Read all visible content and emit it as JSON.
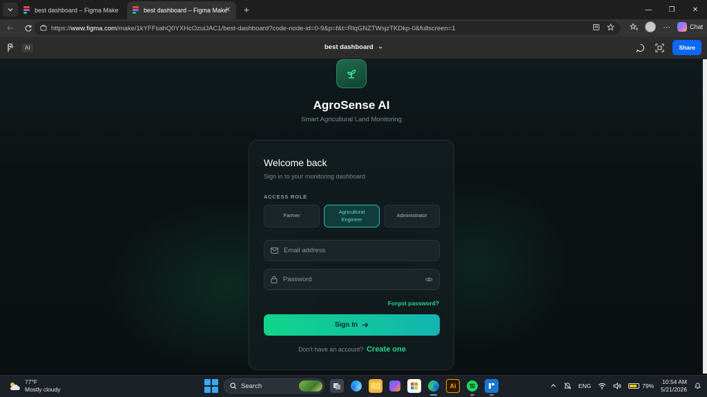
{
  "browser": {
    "tabs": [
      {
        "title": "best dashboard – Figma Make",
        "active": false
      },
      {
        "title": "best dashboard – Figma Make",
        "active": true
      }
    ],
    "url_prefix": "https://",
    "url_host": "www.figma.com",
    "url_path": "/make/1kYFFsahQ0YXHcOzulJAC1/best-dashboard?code-node-id=0-9&p=f&t=RlqGNZTWsjzTKDkp-0&fullscreen=1",
    "copilot_label": "Chat"
  },
  "figma": {
    "ai_label": "AI",
    "file_title": "best dashboard",
    "share_label": "Share"
  },
  "app": {
    "name": "AgroSense AI",
    "tagline": "Smart Agricultural Land Monitoring",
    "card": {
      "heading": "Welcome back",
      "subheading": "Sign in to your monitoring dashboard",
      "role_label": "ACCESS ROLE",
      "roles": [
        {
          "label": "Farmer",
          "selected": false
        },
        {
          "label": "Agricultural Engineer",
          "selected": true
        },
        {
          "label": "Administrator",
          "selected": false
        }
      ],
      "email_placeholder": "Email address",
      "password_placeholder": "Password",
      "forgot_label": "Forgot password?",
      "signin_label": "Sign In",
      "no_account_text": "Don't have an account?",
      "create_label": "Create one"
    },
    "colors": {
      "accent_green": "#22d58a",
      "accent_teal": "#1fc3b2",
      "card_bg": "#121c1f"
    }
  },
  "taskbar": {
    "weather_temp": "77°F",
    "weather_desc": "Mostly cloudy",
    "search_label": "Search",
    "language": "ENG",
    "battery": "79%",
    "battery_level": 0.79,
    "time": "10:54 AM",
    "date": "5/21/2026"
  }
}
